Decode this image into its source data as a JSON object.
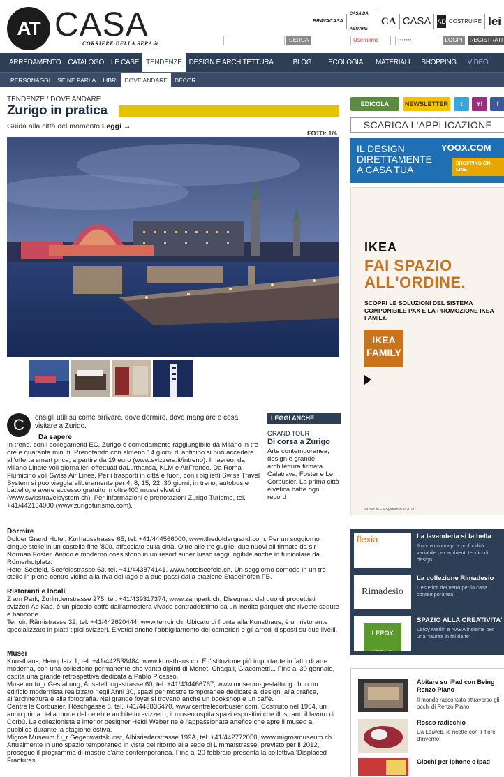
{
  "header": {
    "logo_circle": "AT",
    "logo_word": "CASA",
    "logo_sub": "CORRIERE DELLA SERA.it",
    "partners": [
      "BRAVACASA",
      "CASA DA ABITARE",
      "CA",
      "CASA",
      "AD",
      "COSTRUIRE",
      "lei"
    ],
    "search_button": "CERCA",
    "username_placeholder": "Username",
    "password_value": "•••••••",
    "login_button": "LOGIN",
    "register_button": "REGISTRATI"
  },
  "nav_main": [
    "ARREDAMENTO",
    "CATALOGO",
    "LE CASE",
    "TENDENZE",
    "DESIGN E ARCHITETTURA",
    "BLOG",
    "ECOLOGIA",
    "MATERIALI",
    "SHOPPING",
    "VIDEO"
  ],
  "nav_sub": [
    "PERSONAGGI",
    "SE NE PARLA",
    "LIBRI",
    "DOVE ANDARE",
    "DÉCOR"
  ],
  "article": {
    "breadcrumb": "TENDENZE / DOVE ANDARE",
    "title": "Zurigo in pratica",
    "subtitle": "Guida alla città del momento",
    "subtitle_link": "Leggi →",
    "foto": "FOTO: 1/4",
    "dropcap": "C",
    "intro": "onsigli utili su come arrivare, dove dormire, dove mangiare e cosa visitare a Zurigo.",
    "da_sapere_title": "Da sapere",
    "da_sapere_text": "In treno, con i collegamenti EC, Zurigo è comodamente raggiungibile da Milano in tre ore e quaranta minuti. Prenotando con almeno 14 giorni di anticipo si può accedere all'offerta smart price, a partire da 19 euro (www.svizzera.it/intreno). In aereo, da Milano Linate voli giornalieri effettuati daLufthansa, KLM e AirFrance. Da Roma Fiumicino voli Swiss Air Lines. Per i trasporti in città e fuori, con i biglietti Swiss Travel System si può viaggiareliberamente per 4, 8, 15, 22, 30 giorni, in treno, autobus e battello, e avere accesso gratuito in oltre400 musei elvetici (www.swisstravelsystem.ch). Per informazioni e prenotazioni Zurigo Turismo, tel. +41/442154000 (www.zurigoturismo.com).",
    "dormire_title": "Dormire",
    "dormire_1": "Dolder Grand Hotel, Kurhausstrasse 65, tel. +41/444566000, www.thedoldergrand.com. Per un soggiorno cinque stelle in un castello fine '800, affacciato sulla città. Oltre alle tre guglie, due nuovi ali firmate da sir Norman Foster. Antico e moderno coesistono in un resort super lusso raggiungibile anche in funicolare da Römerhofplatz.",
    "dormire_2": "Hotel Seefeld, Seefeldstrasse 63, tel. +41/443874141, www.hotelseefeld.ch. Un soggiorno comodo in un tre stelle in pieno centro vicino alla riva del lago e a due passi dalla stazione Stadelhofen FB.",
    "ristoranti_title": "Ristoranti e locali",
    "ristoranti_1": "Z am Park, Zurlindenstrasse 275, tel. +41/439317374, www.zampark.ch. Disegnato dal duo di progettisti svizzeri Ae Kae, è un piccolo caffè dall'atmosfera vivace contraddistinto da un inedito parquet che riveste sedute e bancone.",
    "ristoranti_2": "Terroir, Rämistrasse 32, tel. +41/442620444, www.terroir.ch. Ubicato di fronte alla Kunsthaus, è un ristorante specializzato in piatti tipici svizzeri. Elvetici anche l'abbigliamento dei camerieri e gli arredi disposti su due livelli.",
    "musei_title": "Musei",
    "musei_1": "Kunsthaus, Heimplatz 1, tel. +41/442538484, www.kunsthaus.ch. È l'istituzione più importante in fatto di arte moderna, con una collezione permanente che vanta dipinti di Monet, Chagall, Giacometti... Fino al 30 gennaio, ospita una grande retrospettiva dedicata a Pablo Picasso.",
    "musei_2": "Museum fu_r Gestaltung, Ausstellungsstrasse 60, tel. +41/434466767, www.museum-gestaltung.ch In un edificio modernista realizzato negli Anni 30, spazi per mostre temporanee dedicate al design, alla grafica, all'architettura e alla fotografia. Nel grande foyer si trovano anche un bookshop e un caffè.",
    "musei_3": "Centre le Corbusier, Höschgasse 8, tel. +41/443836470, www.centrelecorbusier.com. Costruito nel 1964, un anno prima della morte del celebre architetto svizzero, il museo ospita spazi espositivi che illustrano il lavoro di Corbù. La collezionista e interior designer Heidi Weber ne è l'appassionata artefice che apre il museo al pubblico durante la stagione estiva.",
    "musei_4": "Migros Museum fu_r Gegenwartskunst, Albisriederstrasse 199A, tel. +41/442772050, www.migrosmuseum.ch. Attualmente in uno spazio temporaneo in vista del ritorno alla sede di Limmatstrasse, previsto per il 2012, prosegue il programma di mostre d'arte contemporanea. Fino al 20 febbraio presenta la collettiva 'Displaced Fractures'."
  },
  "leggi_anche": {
    "header": "LEGGI ANCHE",
    "category": "GRAND TOUR",
    "title": "Di corsa a Zurigo",
    "text": "Arte contemporanea, design e grande architettura firmata Calatrava, Foster e Le Corbusier. La prima città elvetica batte ogni record"
  },
  "sidebar": {
    "edicola": "EDICOLA",
    "newsletter": "NEWSLETTER",
    "scarica": "SCARICA L'APPLICAZIONE",
    "banner_line1": "IL DESIGN",
    "banner_line2": "DIRETTAMENTE",
    "banner_line3": "A CASA TUA",
    "banner_brand": "YOOX.COM",
    "banner_cta": "SHOPPING ON-LINE",
    "ikea_logo": "IKEA",
    "ikea_headline": "FAI SPAZIO ALL'ORDINE.",
    "ikea_text": "SCOPRI LE SOLUZIONI DEL SISTEMA COMPONIBILE PAX E LA PROMOZIONE IKEA FAMILY.",
    "ikea_family": "IKEA FAMILY",
    "ikea_foot": "©Inter IKEA System B.V.2011",
    "promos": [
      {
        "label": "flexia",
        "title": "La lavanderia si fa bella",
        "desc": "Il nuovo concept a profondità variabile per ambienti tecnici di design"
      },
      {
        "label": "Rimadesio",
        "title": "La collezione Rimadesio",
        "desc": "L'estetica del vetro per la casa contemporanea"
      },
      {
        "label": "LEROY MERLIN",
        "title": "SPAZIO ALLA CREATIVITA'",
        "desc": "Leroy Merlin e NABA insieme per una \"laurea in fai da te\""
      }
    ],
    "news": [
      {
        "title": "Abitare su iPad con Being Renzo Piano",
        "desc": "Il mondo raccontato attraverso gli occhi di Renzo Piano"
      },
      {
        "title": "Rosso radicchio",
        "desc": "Da Leiweb, le ricette con il 'fiore d'inverno'"
      },
      {
        "title": "Giochi per Iphone e Ipad",
        "desc": ""
      }
    ]
  }
}
